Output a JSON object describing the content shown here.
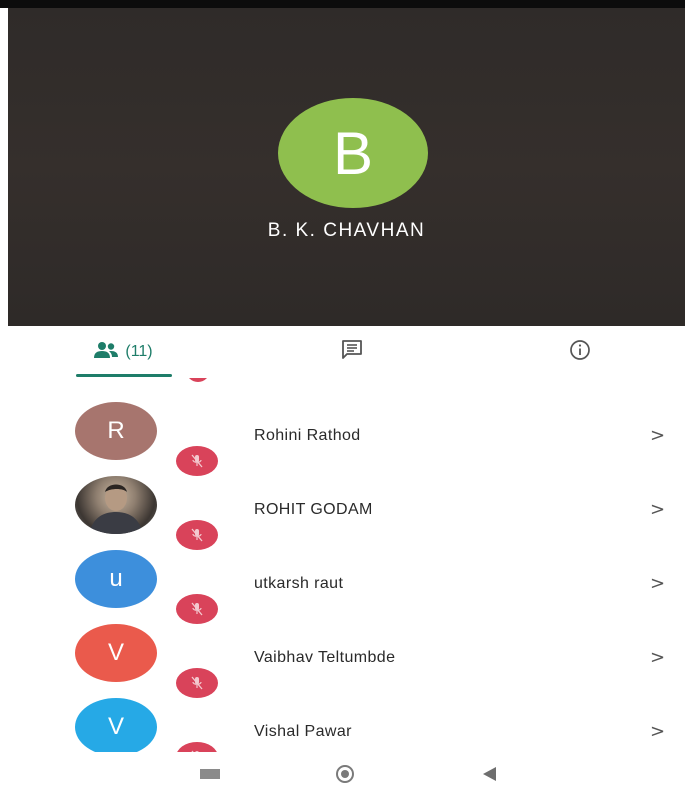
{
  "speaker": {
    "avatar_letter": "B",
    "avatar_color": "#8fbf4e",
    "name": "B. K. CHAVHAN"
  },
  "tabs": {
    "people": {
      "icon": "people-icon",
      "count_label": "(11)",
      "active": true
    },
    "chat": {
      "icon": "chat-icon"
    },
    "info": {
      "icon": "info-icon"
    },
    "accent_color": "#1e7d69"
  },
  "participants": [
    {
      "name": "Rohini Rathod",
      "avatar_letter": "R",
      "avatar_color": "#a7756e",
      "muted": true,
      "chevron": ">"
    },
    {
      "name": "ROHIT GODAM",
      "avatar_letter": "",
      "avatar_type": "photo",
      "muted": true,
      "chevron": ">"
    },
    {
      "name": "utkarsh raut",
      "avatar_letter": "u",
      "avatar_color": "#3d8fdc",
      "muted": true,
      "chevron": ">"
    },
    {
      "name": "Vaibhav Teltumbde",
      "avatar_letter": "V",
      "avatar_color": "#ea5a4c",
      "muted": true,
      "chevron": ">"
    },
    {
      "name": "Vishal Pawar",
      "avatar_letter": "V",
      "avatar_color": "#26a9e6",
      "muted": true,
      "chevron": ">"
    }
  ],
  "mute_badge_color": "#d9435a",
  "navbar": {
    "recent": "recent-apps-icon",
    "home": "home-icon",
    "back": "back-icon"
  }
}
